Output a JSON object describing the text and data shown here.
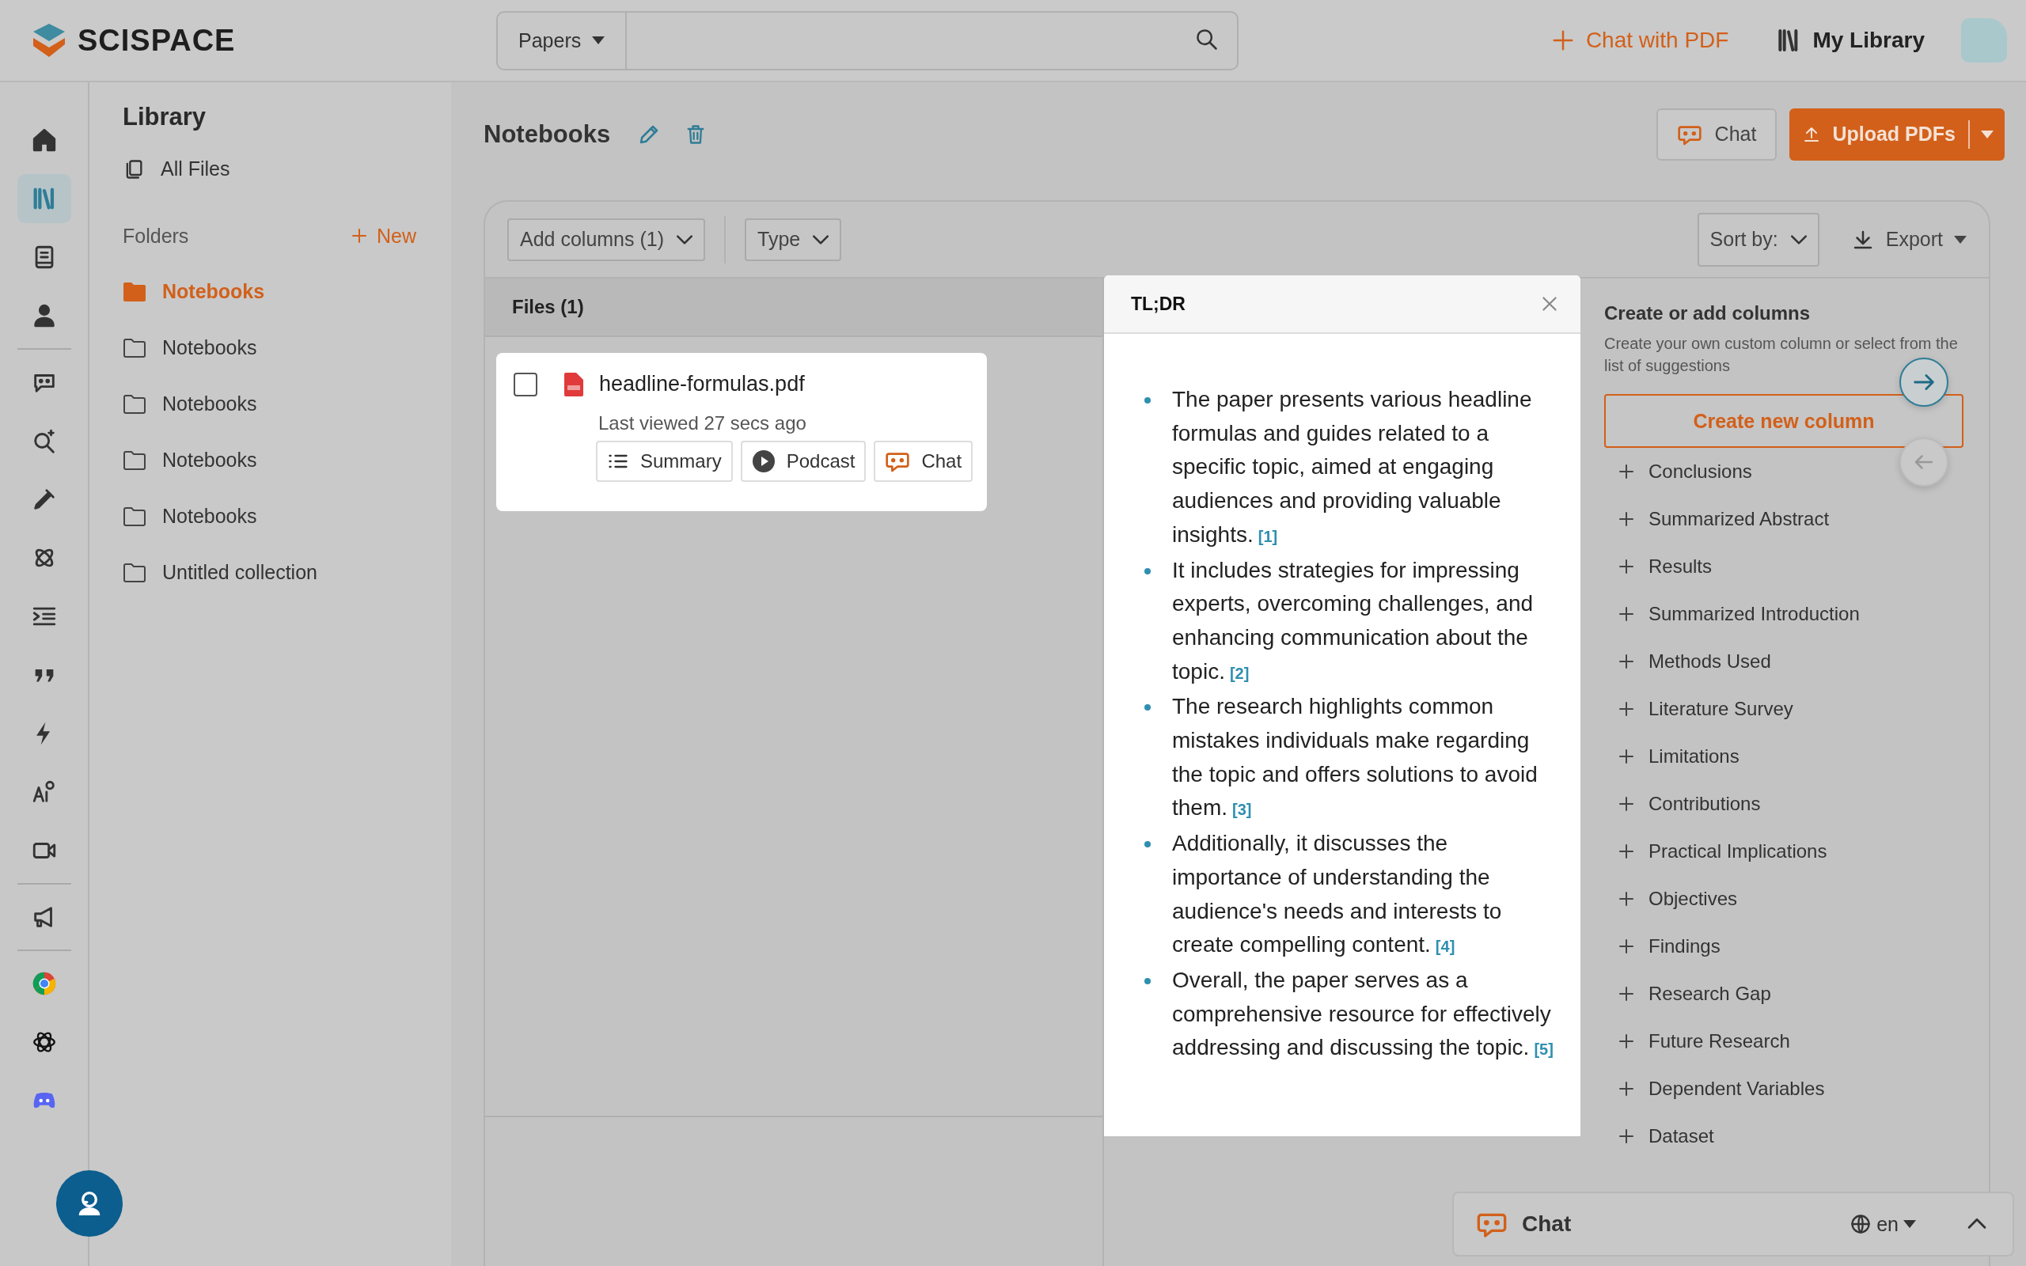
{
  "topbar": {
    "logo": "SCISPACE",
    "search_scope": "Papers",
    "chat_with_pdf": "Chat with PDF",
    "my_library": "My Library"
  },
  "rail": [
    {
      "kind": "button",
      "selected": false
    },
    {
      "kind": "button",
      "selected": true
    },
    {
      "kind": "button",
      "selected": false
    },
    {
      "kind": "button",
      "selected": false
    },
    {
      "kind": "divider"
    },
    {
      "kind": "button",
      "selected": false
    },
    {
      "kind": "button",
      "selected": false
    },
    {
      "kind": "button",
      "selected": false
    },
    {
      "kind": "button",
      "selected": false
    },
    {
      "kind": "button",
      "selected": false
    },
    {
      "kind": "button",
      "selected": false
    },
    {
      "kind": "button",
      "selected": false
    },
    {
      "kind": "button",
      "selected": false
    },
    {
      "kind": "button",
      "selected": false
    },
    {
      "kind": "divider"
    },
    {
      "kind": "button",
      "selected": false
    },
    {
      "kind": "divider"
    },
    {
      "kind": "button",
      "selected": false
    },
    {
      "kind": "button",
      "selected": false
    },
    {
      "kind": "button",
      "selected": false
    }
  ],
  "library": {
    "title": "Library",
    "all_files": "All Files",
    "folders_label": "Folders",
    "new_button": "New",
    "folders": [
      {
        "name": "Notebooks",
        "selected": true
      },
      {
        "name": "Notebooks",
        "selected": false
      },
      {
        "name": "Notebooks",
        "selected": false
      },
      {
        "name": "Notebooks",
        "selected": false
      },
      {
        "name": "Notebooks",
        "selected": false
      },
      {
        "name": "Untitled collection",
        "selected": false
      }
    ]
  },
  "header": {
    "title": "Notebooks",
    "chat_button": "Chat",
    "upload_button": "Upload PDFs"
  },
  "toolbar": {
    "add_columns": "Add columns (1)",
    "type_filter": "Type",
    "sort": "Sort by:",
    "export": "Export"
  },
  "files": {
    "heading": "Files (1)",
    "items": [
      {
        "name": "headline-formulas.pdf",
        "checked": false,
        "last_viewed": "Last viewed 27 secs ago",
        "actions": [
          "Summary",
          "Podcast",
          "Chat"
        ]
      }
    ]
  },
  "tldr": {
    "title": "TL;DR",
    "bullets": [
      {
        "text": "The paper presents various headline formulas and guides related to a specific topic, aimed at engaging audiences and providing valuable insights.",
        "citation": "[1]"
      },
      {
        "text": "It includes strategies for impressing experts, overcoming challenges, and enhancing communication about the topic.",
        "citation": "[2]"
      },
      {
        "text": "The research highlights common mistakes individuals make regarding the topic and offers solutions to avoid them.",
        "citation": "[3]"
      },
      {
        "text": "Additionally, it discusses the importance of understanding the audience's needs and interests to create compelling content.",
        "citation": "[4]"
      },
      {
        "text": "Overall, the paper serves as a comprehensive resource for effectively addressing and discussing the topic.",
        "citation": "[5]"
      }
    ]
  },
  "suggestions": {
    "title": "Create or add columns",
    "description": "Create your own custom column or select from the list of suggestions",
    "create_button": "Create new column",
    "items": [
      "Conclusions",
      "Summarized Abstract",
      "Results",
      "Summarized Introduction",
      "Methods Used",
      "Literature Survey",
      "Limitations",
      "Contributions",
      "Practical Implications",
      "Objectives",
      "Findings",
      "Research Gap",
      "Future Research",
      "Dependent Variables",
      "Dataset"
    ]
  },
  "chat_bar": {
    "label": "Chat",
    "language": "en"
  }
}
